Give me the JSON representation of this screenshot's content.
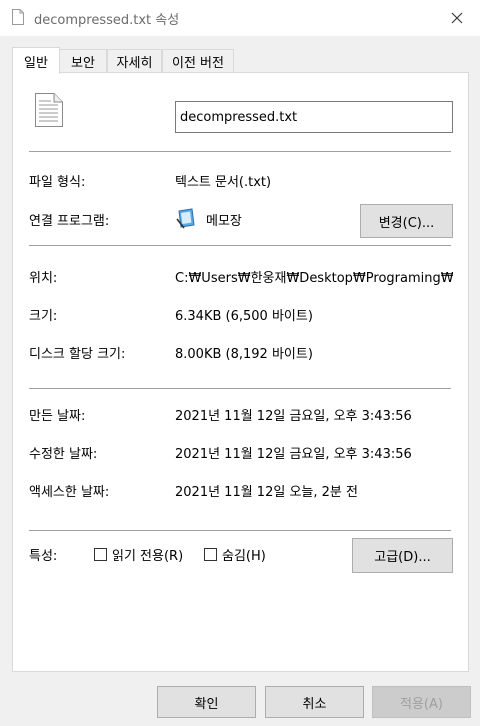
{
  "window": {
    "title": "decompressed.txt 속성"
  },
  "tabs": [
    "일반",
    "보안",
    "자세히",
    "이전 버전"
  ],
  "general": {
    "file_name": "decompressed.txt",
    "type_label": "파일 형식:",
    "type_value": "텍스트 문서(.txt)",
    "opens_with_label": "연결 프로그램:",
    "opens_with_value": "메모장",
    "change_button": "변경(C)...",
    "location_label": "위치:",
    "location_value": "C:₩Users₩한웅재₩Desktop₩Programing₩C",
    "size_label": "크기:",
    "size_value": "6.34KB (6,500 바이트)",
    "size_on_disk_label": "디스크 할당 크기:",
    "size_on_disk_value": "8.00KB (8,192 바이트)",
    "created_label": "만든 날짜:",
    "created_value": "2021년 11월 12일 금요일, 오후 3:43:56",
    "modified_label": "수정한 날짜:",
    "modified_value": "2021년 11월 12일 금요일, 오후 3:43:56",
    "accessed_label": "액세스한 날짜:",
    "accessed_value": "2021년 11월 12일 오늘, 2분 전",
    "attributes_label": "특성:",
    "readonly_label": "읽기 전용(R)",
    "hidden_label": "숨김(H)",
    "advanced_button": "고급(D)..."
  },
  "footer": {
    "ok": "확인",
    "cancel": "취소",
    "apply": "적용(A)"
  }
}
